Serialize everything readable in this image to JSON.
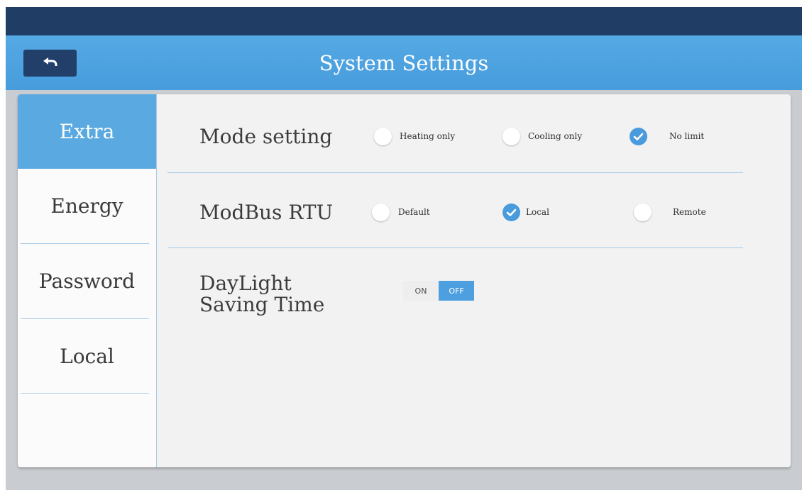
{
  "window": {
    "title": "System Settings",
    "back_icon": "back-arrow-icon"
  },
  "sidebar": {
    "items": [
      {
        "label": "Extra",
        "active": true
      },
      {
        "label": "Energy",
        "active": false
      },
      {
        "label": "Password",
        "active": false
      },
      {
        "label": "Local",
        "active": false
      }
    ]
  },
  "settings": {
    "mode": {
      "label": "Mode setting",
      "options": [
        {
          "label": "Heating only",
          "checked": false
        },
        {
          "label": "Cooling only",
          "checked": false
        },
        {
          "label": "No limit",
          "checked": true
        }
      ]
    },
    "modbus": {
      "label": "ModBus RTU",
      "options": [
        {
          "label": "Default",
          "checked": false
        },
        {
          "label": "Local",
          "checked": true
        },
        {
          "label": "Remote",
          "checked": false
        }
      ]
    },
    "dst": {
      "label_line1": "DayLight",
      "label_line2": "Saving Time",
      "on_label": "ON",
      "off_label": "OFF",
      "selected": "OFF"
    }
  },
  "colors": {
    "top_bar": "#203d66",
    "title_bar": "#4a9fdf",
    "accent": "#4a9bdc"
  }
}
